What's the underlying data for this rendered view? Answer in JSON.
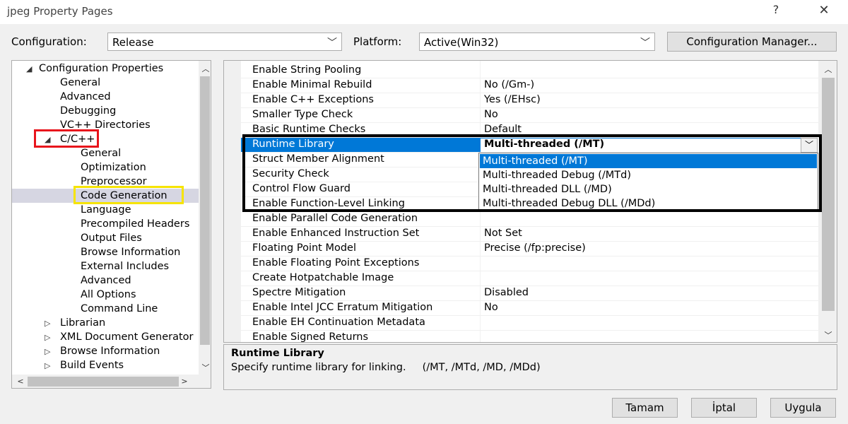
{
  "window": {
    "title": "jpeg Property Pages",
    "help_glyph": "?",
    "close_glyph": "✕"
  },
  "config_row": {
    "configuration_label": "Configuration:",
    "configuration_value": "Release",
    "platform_label": "Platform:",
    "platform_value": "Active(Win32)",
    "config_manager_label": "Configuration Manager..."
  },
  "tree": {
    "items": [
      {
        "label": "Configuration Properties",
        "arrow": "◢"
      },
      {
        "label": "General"
      },
      {
        "label": "Advanced"
      },
      {
        "label": "Debugging"
      },
      {
        "label": "VC++ Directories"
      },
      {
        "label": "C/C++",
        "arrow": "◢"
      },
      {
        "label": "General"
      },
      {
        "label": "Optimization"
      },
      {
        "label": "Preprocessor"
      },
      {
        "label": "Code Generation"
      },
      {
        "label": "Language"
      },
      {
        "label": "Precompiled Headers"
      },
      {
        "label": "Output Files"
      },
      {
        "label": "Browse Information"
      },
      {
        "label": "External Includes"
      },
      {
        "label": "Advanced"
      },
      {
        "label": "All Options"
      },
      {
        "label": "Command Line"
      },
      {
        "label": "Librarian",
        "arrow": "▷"
      },
      {
        "label": "XML Document Generator",
        "arrow": "▷"
      },
      {
        "label": "Browse Information",
        "arrow": "▷"
      },
      {
        "label": "Build Events",
        "arrow": "▷"
      }
    ],
    "selected_item": "Code Generation"
  },
  "properties": [
    {
      "name": "Enable String Pooling",
      "value": ""
    },
    {
      "name": "Enable Minimal Rebuild",
      "value": "No (/Gm-)"
    },
    {
      "name": "Enable C++ Exceptions",
      "value": "Yes (/EHsc)"
    },
    {
      "name": "Smaller Type Check",
      "value": "No"
    },
    {
      "name": "Basic Runtime Checks",
      "value": "Default"
    },
    {
      "name": "Runtime Library",
      "value": "Multi-threaded (/MT)"
    },
    {
      "name": "Struct Member Alignment",
      "value": ""
    },
    {
      "name": "Security Check",
      "value": ""
    },
    {
      "name": "Control Flow Guard",
      "value": ""
    },
    {
      "name": "Enable Function-Level Linking",
      "value": ""
    },
    {
      "name": "Enable Parallel Code Generation",
      "value": ""
    },
    {
      "name": "Enable Enhanced Instruction Set",
      "value": "Not Set"
    },
    {
      "name": "Floating Point Model",
      "value": "Precise (/fp:precise)"
    },
    {
      "name": "Enable Floating Point Exceptions",
      "value": ""
    },
    {
      "name": "Create Hotpatchable Image",
      "value": ""
    },
    {
      "name": "Spectre Mitigation",
      "value": "Disabled"
    },
    {
      "name": "Enable Intel JCC Erratum Mitigation",
      "value": "No"
    },
    {
      "name": "Enable EH Continuation Metadata",
      "value": ""
    },
    {
      "name": "Enable Signed Returns",
      "value": ""
    }
  ],
  "runtime_dropdown": {
    "options": [
      "Multi-threaded (/MT)",
      "Multi-threaded Debug (/MTd)",
      "Multi-threaded DLL (/MD)",
      "Multi-threaded Debug DLL (/MDd)"
    ],
    "selected": "Multi-threaded (/MT)"
  },
  "description": {
    "title": "Runtime Library",
    "text": "Specify runtime library for linking.     (/MT, /MTd, /MD, /MDd)"
  },
  "buttons": {
    "ok": "Tamam",
    "cancel": "İptal",
    "apply": "Uygula"
  },
  "annotation_colors": {
    "red_box": "#e8141c",
    "yellow_box": "#f6e400",
    "black_box": "#000000",
    "selection": "#0078d7"
  }
}
